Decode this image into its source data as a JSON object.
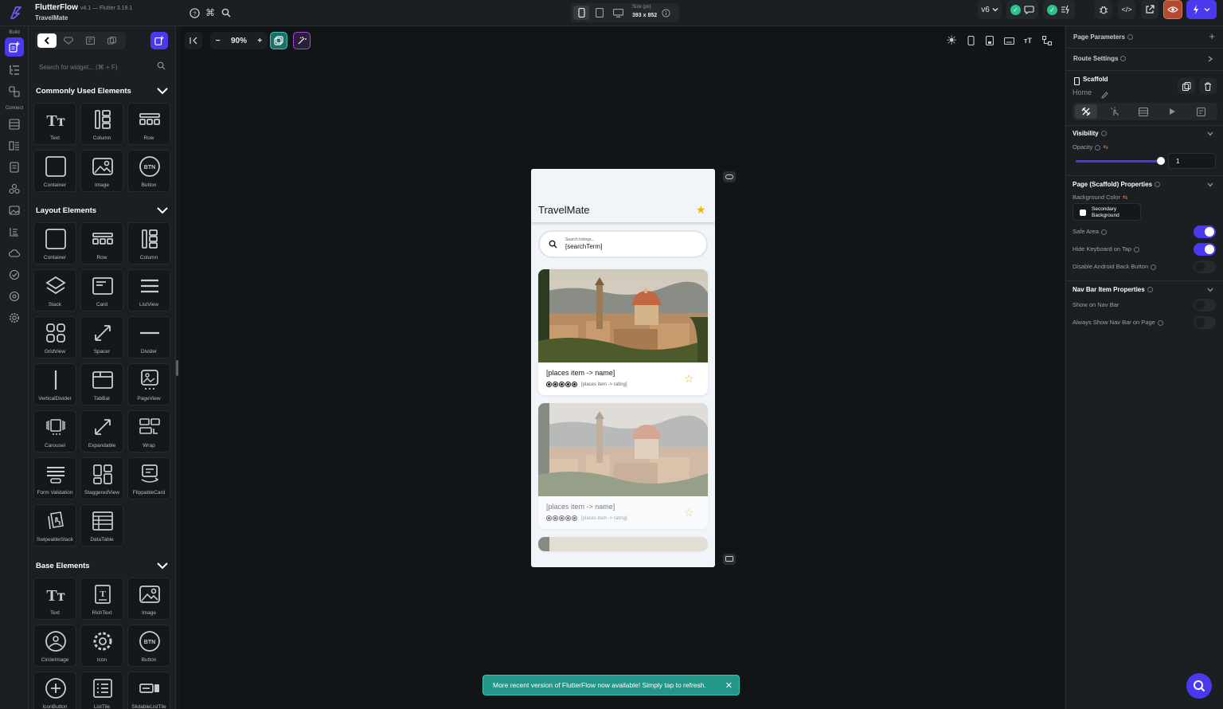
{
  "app": {
    "name": "FlutterFlow",
    "version": "v4.1 — Flutter 3.19.1",
    "project": "TravelMate"
  },
  "device": {
    "size_label": "Size (px)",
    "size_value": "393 x 852"
  },
  "toolbar": {
    "branch": "v6"
  },
  "rail": {
    "build_label": "Build",
    "connect_label": "Connect"
  },
  "widgets": {
    "search_placeholder": "Search for widget... (⌘ + F)",
    "sections": [
      {
        "title": "Commonly Used Elements",
        "items": [
          "Text",
          "Column",
          "Row",
          "Container",
          "Image",
          "Button"
        ]
      },
      {
        "title": "Layout Elements",
        "items": [
          "Container",
          "Row",
          "Column",
          "Stack",
          "Card",
          "ListView",
          "GridView",
          "Spacer",
          "Divider",
          "VerticalDivider",
          "TabBar",
          "PageView",
          "Carousel",
          "Expandable",
          "Wrap",
          "Form Validation",
          "StaggeredView",
          "FlippableCard",
          "SwipeableStack",
          "DataTable"
        ]
      },
      {
        "title": "Base Elements",
        "items": [
          "Text",
          "RichText",
          "Image",
          "CircleImage",
          "Icon",
          "Button",
          "IconButton",
          "ListTile",
          "SlidableListTile"
        ]
      }
    ]
  },
  "canvas": {
    "zoom": "90%"
  },
  "phone": {
    "title": "TravelMate",
    "search_label": "Search listings...",
    "search_value": "[searchTerm]",
    "card_name": "[places item -> name]",
    "card_rating": "[places item -> rating]"
  },
  "toast": {
    "message": "More recent version of FlutterFlow now available! Simply tap to refresh."
  },
  "props": {
    "page_parameters": "Page Parameters",
    "route_settings": "Route Settings",
    "widget_type": "Scaffold",
    "page_name": "Home",
    "visibility": "Visibility",
    "opacity_label": "Opacity",
    "opacity_value": "1",
    "scaffold_props": "Page (Scaffold) Properties",
    "bg_color_label": "Background Color",
    "bg_color_line1": "Secondary",
    "bg_color_line2": "Background",
    "safe_area": "Safe Area",
    "hide_keyboard": "Hide Keyboard on Tap",
    "disable_back": "Disable Android Back Button",
    "nav_bar_props": "Nav Bar Item Properties",
    "show_nav": "Show on Nav Bar",
    "always_nav": "Always Show Nav Bar on Page"
  },
  "colors": {
    "accent": "#4b39ef",
    "bg": "#14181b",
    "panel": "#1b1f22",
    "toast": "#249689",
    "star": "#f5b800",
    "check": "#2cc28c"
  }
}
